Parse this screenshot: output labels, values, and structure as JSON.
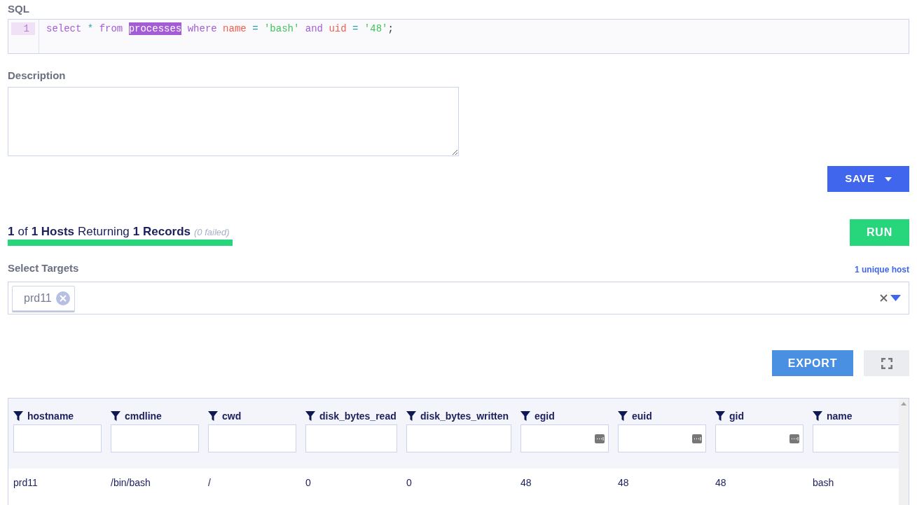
{
  "sql": {
    "label": "SQL",
    "line_number": "1",
    "tokens": [
      {
        "kind": "keyword",
        "text": "select",
        "selected": false
      },
      {
        "kind": "operator",
        "text": "*",
        "selected": false
      },
      {
        "kind": "keyword",
        "text": "from",
        "selected": false
      },
      {
        "kind": "table",
        "text": "processes",
        "selected": true
      },
      {
        "kind": "keyword",
        "text": "where",
        "selected": false
      },
      {
        "kind": "column",
        "text": "name",
        "selected": false
      },
      {
        "kind": "operator",
        "text": "=",
        "selected": false
      },
      {
        "kind": "string",
        "text": "'bash'",
        "selected": false
      },
      {
        "kind": "keyword",
        "text": "and",
        "selected": false
      },
      {
        "kind": "column",
        "text": "uid",
        "selected": false
      },
      {
        "kind": "operator",
        "text": "=",
        "selected": false
      },
      {
        "kind": "string",
        "text": "'48'",
        "selected": false
      },
      {
        "kind": "punct",
        "text": ";",
        "selected": false
      }
    ]
  },
  "description": {
    "label": "Description"
  },
  "save_button": "SAVE",
  "status": {
    "parts": [
      {
        "kind": "bold",
        "text": "1"
      },
      {
        "kind": "plain",
        "text": "of"
      },
      {
        "kind": "bold",
        "text": "1 Hosts"
      },
      {
        "kind": "plain",
        "text": "Returning"
      },
      {
        "kind": "bold",
        "text": "1 Records"
      },
      {
        "kind": "muted",
        "text": "(0 failed)"
      }
    ],
    "level": 1
  },
  "run_button": "RUN",
  "targets": {
    "label": "Select Targets",
    "count": "1 unique host",
    "chips": [
      "prd11"
    ]
  },
  "export_button": "EXPORT",
  "table": {
    "columns": [
      {
        "name": "hostname",
        "kind": "text"
      },
      {
        "name": "cmdline",
        "kind": "text"
      },
      {
        "name": "cwd",
        "kind": "text"
      },
      {
        "name": "disk_bytes_read",
        "kind": "text"
      },
      {
        "name": "disk_bytes_written",
        "kind": "text"
      },
      {
        "name": "egid",
        "kind": "number"
      },
      {
        "name": "euid",
        "kind": "number"
      },
      {
        "name": "gid",
        "kind": "number"
      },
      {
        "name": "name",
        "kind": "text"
      }
    ],
    "rows": [
      [
        "prd11",
        "/bin/bash",
        "/",
        "0",
        "0",
        "48",
        "48",
        "48",
        "bash"
      ]
    ]
  }
}
